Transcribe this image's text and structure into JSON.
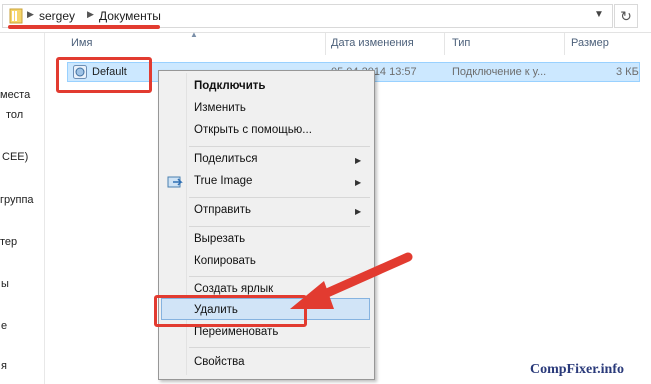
{
  "address_bar": {
    "crumbs": [
      "sergey",
      "Документы"
    ],
    "dropdown_icon": "chevron-down-icon",
    "refresh_icon": "refresh-icon"
  },
  "nav_pane": {
    "items": [
      "места",
      "тол",
      "CEE)",
      "группа",
      "тер",
      "ы",
      "е",
      "я"
    ]
  },
  "columns": {
    "name": "Имя",
    "date": "Дата изменения",
    "type": "Тип",
    "size": "Размер"
  },
  "selected_file": {
    "name": "Default",
    "date": "05.04.2014 13:57",
    "type": "Подключение к у...",
    "size": "3 КБ"
  },
  "context_menu": {
    "connect": "Подключить",
    "edit": "Изменить",
    "open_with": "Открыть с помощью...",
    "share": "Поделиться",
    "true_image": "True Image",
    "send_to": "Отправить",
    "cut": "Вырезать",
    "copy": "Копировать",
    "create_shortcut": "Создать ярлык",
    "delete": "Удалить",
    "rename": "Переименовать",
    "properties": "Свойства"
  },
  "watermark": "CompFixer.info",
  "colors": {
    "annotation_red": "#e23b30",
    "selection_blue": "#cce8ff",
    "menu_highlight": "#d1e4f7"
  }
}
